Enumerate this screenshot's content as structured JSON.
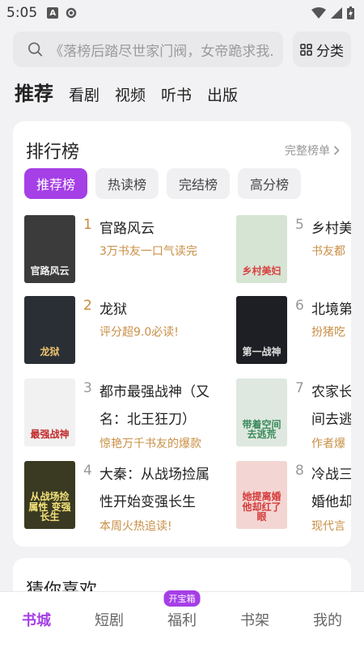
{
  "status_bar": {
    "time": "5:05",
    "icons": [
      "a-notification-icon",
      "settings-gear-icon",
      "wifi-icon",
      "signal-icon",
      "battery-icon"
    ]
  },
  "search": {
    "placeholder": "《落榜后踏尽世家门阀，女帝跪求我...",
    "category_label": "分类"
  },
  "top_tabs": [
    {
      "label": "推荐",
      "active": true
    },
    {
      "label": "看剧"
    },
    {
      "label": "视频"
    },
    {
      "label": "听书"
    },
    {
      "label": "出版"
    }
  ],
  "ranking": {
    "title": "排行榜",
    "more_label": "完整榜单",
    "chips": [
      {
        "label": "推荐榜",
        "active": true
      },
      {
        "label": "热读榜"
      },
      {
        "label": "完结榜"
      },
      {
        "label": "高分榜"
      }
    ],
    "books": [
      {
        "rank": "1",
        "title": "官路风云",
        "desc": "3万书友一口气读完",
        "cover_text": "官路风云",
        "cover_bg": "#3b3b3b",
        "cover_color": "#f2f2f2"
      },
      {
        "rank": "2",
        "title": "龙狱",
        "desc": "评分超9.0必读!",
        "cover_text": "龙狱",
        "cover_bg": "#2a2f36",
        "cover_color": "#f0c36b"
      },
      {
        "rank": "3",
        "title": "都市最强战神（又名：北王狂刀）",
        "desc": "惊艳万千书友的爆款",
        "cover_text": "最强战神",
        "cover_bg": "#f1f1f1",
        "cover_color": "#c42b2b"
      },
      {
        "rank": "4",
        "title": "大秦：从战场捡属性开始变强长生",
        "desc": "本周火热追读!",
        "cover_text": "从战场捡属性 变强长生",
        "cover_bg": "#3a3a22",
        "cover_color": "#f4e27a"
      },
      {
        "rank": "5",
        "title": "乡村美",
        "desc": "书友都",
        "cover_text": "乡村美妇",
        "cover_bg": "#d6e4d4",
        "cover_color": "#d94040"
      },
      {
        "rank": "6",
        "title": "北境第",
        "desc": "扮猪吃",
        "cover_text": "第一战神",
        "cover_bg": "#1d1f24",
        "cover_color": "#e0e0e0"
      },
      {
        "rank": "7",
        "title": "农家长间去逃",
        "desc": "作者爆",
        "cover_text": "带着空间去逃荒",
        "cover_bg": "#dfe8e0",
        "cover_color": "#3a8a5a"
      },
      {
        "rank": "8",
        "title": "冷战三婚他却",
        "desc": "现代言",
        "cover_text": "她提离婚 他却红了眼",
        "cover_bg": "#f3d6d3",
        "cover_color": "#d43a3a"
      }
    ]
  },
  "guess": {
    "title": "猜你喜欢"
  },
  "bottom_nav": [
    {
      "label": "书城",
      "active": true
    },
    {
      "label": "短剧"
    },
    {
      "label": "福利",
      "badge": "开宝箱"
    },
    {
      "label": "书架"
    },
    {
      "label": "我的"
    }
  ],
  "colors": {
    "accent": "#a53fe6",
    "rank_gold": "#c7893c",
    "desc_orange": "#c98f46"
  }
}
